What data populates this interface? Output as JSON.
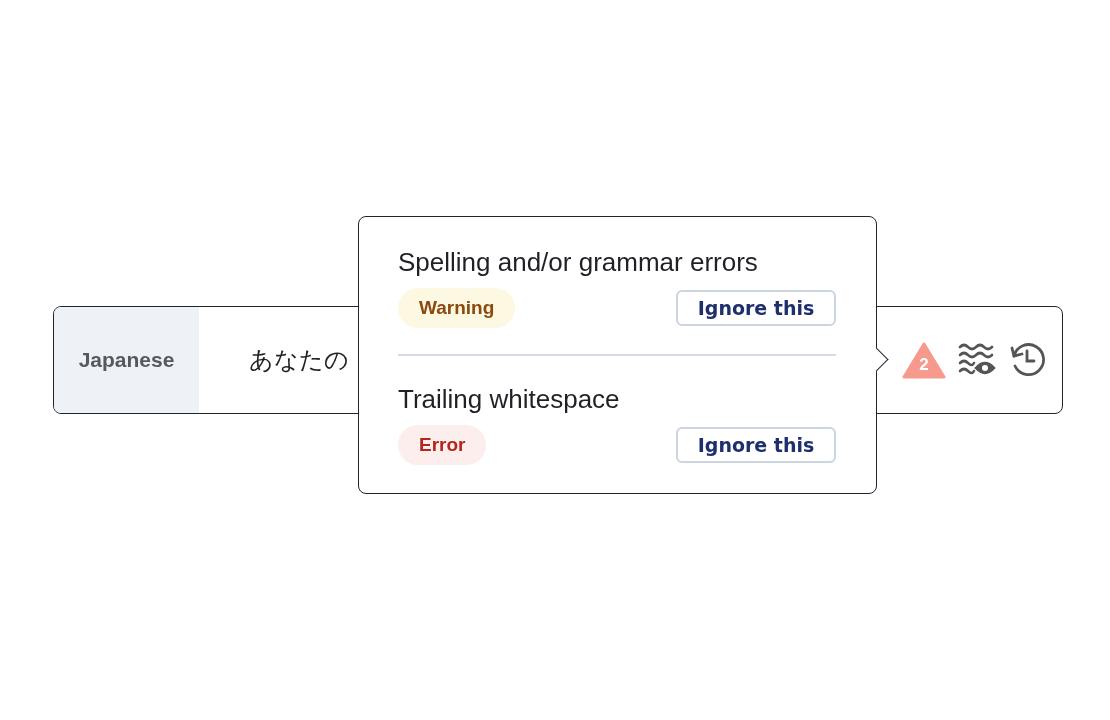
{
  "row": {
    "language": "Japanese",
    "text": "あなたの",
    "issue_count": "2"
  },
  "popover": {
    "issues": [
      {
        "title": "Spelling and/or grammar errors",
        "kind": "warning",
        "severity": "Warning",
        "action": "Ignore this"
      },
      {
        "title": "Trailing whitespace",
        "kind": "error",
        "severity": "Error",
        "action": "Ignore this"
      }
    ]
  }
}
